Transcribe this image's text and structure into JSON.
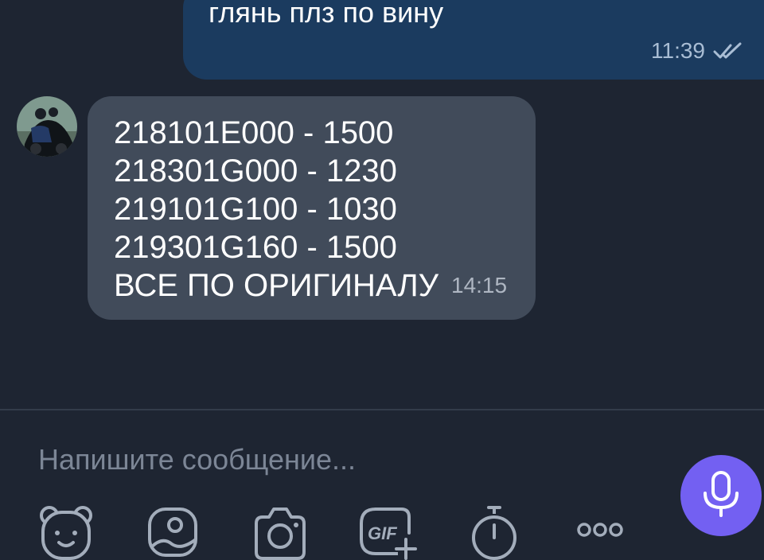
{
  "messages": {
    "outgoing": {
      "text": "глянь плз по вину",
      "time": "11:39",
      "status_icon": "double-check-icon"
    },
    "incoming": {
      "lines": [
        "218101E000 - 1500",
        "218301G000 - 1230",
        "219101G100 - 1030",
        "219301G160 - 1500",
        "ВСЕ ПО ОРИГИНАЛУ"
      ],
      "time": "14:15"
    }
  },
  "composer": {
    "placeholder": "Напишите сообщение...",
    "value": ""
  },
  "toolbar": {
    "items": [
      "sticker-bear-icon",
      "gallery-icon",
      "camera-icon",
      "gif-icon",
      "timer-icon",
      "more-icon"
    ],
    "gif_label": "GIF"
  },
  "colors": {
    "background": "#1e2532",
    "outgoing_bubble": "#1b3b5f",
    "incoming_bubble": "#414b5a",
    "accent": "#7360f2",
    "icon": "#a3adbb"
  }
}
